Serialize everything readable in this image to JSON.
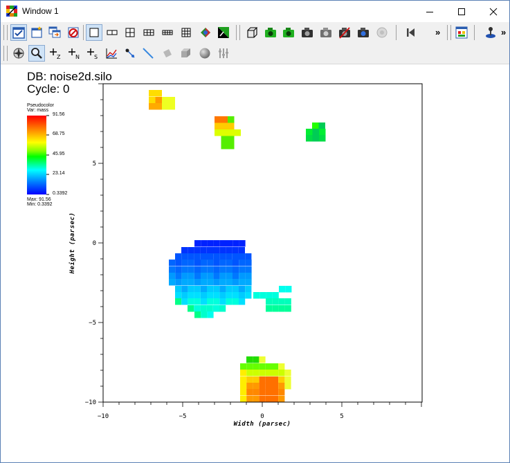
{
  "window": {
    "title": "Window 1"
  },
  "toolbar1": {
    "overflow": "»",
    "overflow2": "»"
  },
  "plot": {
    "db_label": "DB: noise2d.silo",
    "cycle_label": "Cycle: 0",
    "legend": {
      "plot_type": "Pseudocolor",
      "var": "Var: mass",
      "ticks": [
        "91.56",
        "68.75",
        "45.95",
        "23.14",
        "0.3392"
      ],
      "max": "Max: 91.56",
      "min": "Min: 0.3392"
    },
    "x_axis": {
      "title": "Width (parsec)",
      "ticks": [
        "−10",
        "−5",
        "0",
        "5"
      ]
    },
    "y_axis": {
      "title": "Height (parsec)",
      "ticks": [
        "5",
        "0",
        "−5",
        "−10"
      ]
    }
  }
}
